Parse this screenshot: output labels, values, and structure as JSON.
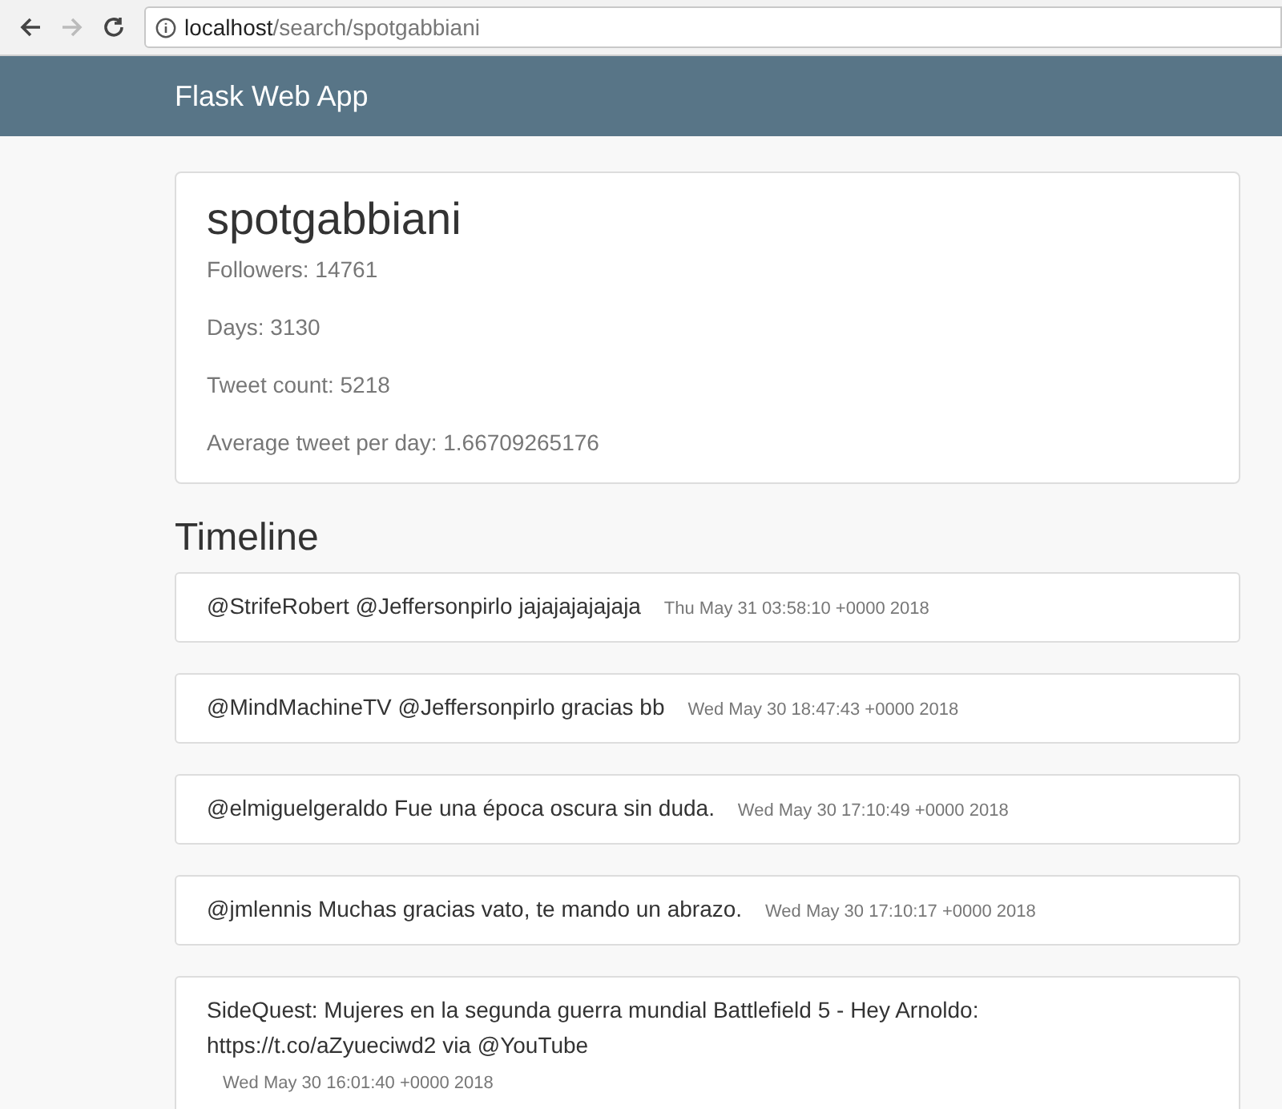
{
  "browser": {
    "url_host": "localhost",
    "url_path": "/search/spotgabbiani",
    "back_disabled": false,
    "forward_disabled": true
  },
  "navbar": {
    "brand": "Flask Web App"
  },
  "profile": {
    "username": "spotgabbiani",
    "stats": [
      "Followers: 14761",
      "Days: 3130",
      "Tweet count: 5218",
      "Average tweet per day: 1.66709265176"
    ]
  },
  "timeline": {
    "heading": "Timeline",
    "tweets": [
      {
        "text": "@StrifeRobert @Jeffersonpirlo jajajajajajaja",
        "date": "Thu May 31 03:58:10 +0000 2018"
      },
      {
        "text": "@MindMachineTV @Jeffersonpirlo gracias bb",
        "date": "Wed May 30 18:47:43 +0000 2018"
      },
      {
        "text": "@elmiguelgeraldo Fue una época oscura sin duda.",
        "date": "Wed May 30 17:10:49 +0000 2018"
      },
      {
        "text": "@jmlennis Muchas gracias vato, te mando un abrazo.",
        "date": "Wed May 30 17:10:17 +0000 2018"
      },
      {
        "text": "SideQuest: Mujeres en la segunda guerra mundial Battlefield 5 - Hey Arnoldo: https://t.co/aZyueciwd2 via @YouTube",
        "date": "Wed May 30 16:01:40 +0000 2018"
      }
    ]
  }
}
